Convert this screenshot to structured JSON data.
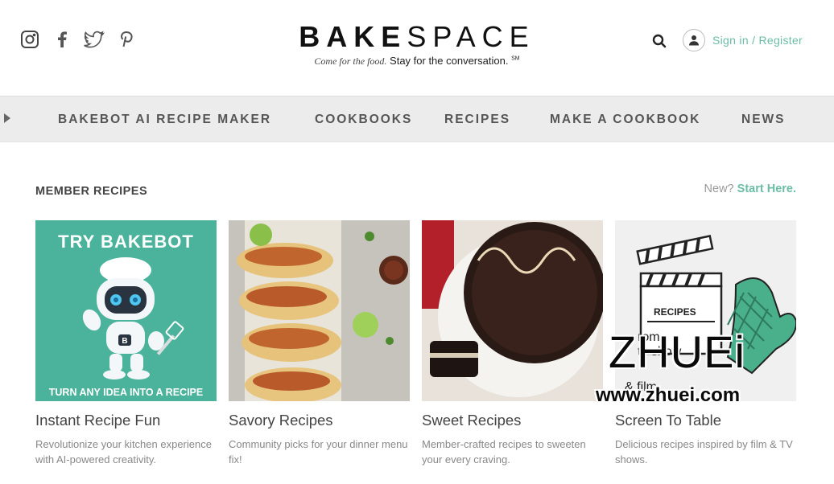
{
  "header": {
    "brand_bold": "BAKE",
    "brand_light": "SPACE",
    "tagline_script": "Come for the food.",
    "tagline_text": "Stay for the conversation.",
    "tagline_mark": "SM",
    "signin_label": "Sign in / Register",
    "social": [
      "instagram-icon",
      "facebook-icon",
      "twitter-icon",
      "pinterest-icon"
    ]
  },
  "nav": {
    "items": [
      {
        "label": "BAKEBOT AI RECIPE MAKER"
      },
      {
        "label": "COOKBOOKS"
      },
      {
        "label": "RECIPES"
      },
      {
        "label": "MAKE A COOKBOOK"
      },
      {
        "label": "NEWS"
      }
    ]
  },
  "section": {
    "title": "MEMBER RECIPES",
    "new_label": "New?",
    "start_label": "Start Here."
  },
  "cards": [
    {
      "image_top_text": "TRY BAKEBOT",
      "image_bottom_text": "TURN ANY IDEA INTO A RECIPE",
      "title": "Instant Recipe Fun",
      "desc": "Revolutionize your kitchen experience with AI-powered creativity."
    },
    {
      "title": "Savory Recipes",
      "desc": "Community picks for your dinner menu fix!"
    },
    {
      "title": "Sweet Recipes",
      "desc": "Member-crafted recipes to sweeten your every craving."
    },
    {
      "image_label": "RECIPES",
      "image_text_1": "rom",
      "image_text_2": "tv show",
      "image_text_3": "& film",
      "title": "Screen To Table",
      "desc": "Delicious recipes inspired by film & TV shows."
    }
  ],
  "watermark": {
    "big": "ZHUEi",
    "small": "www.zhuei.com"
  },
  "colors": {
    "accent": "#6bbda4",
    "nav_bg": "#ececec",
    "teal_card": "#4bb39c"
  }
}
